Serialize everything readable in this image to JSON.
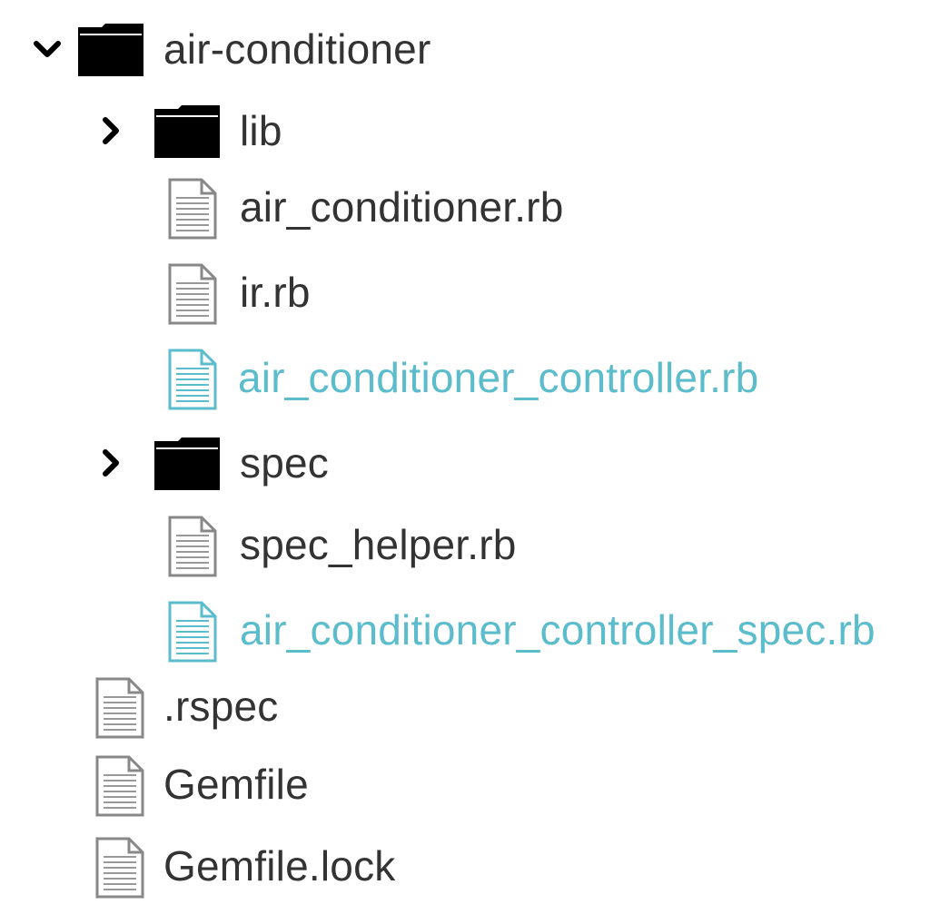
{
  "tree": {
    "root": {
      "label": "air-conditioner",
      "expanded": true
    },
    "lib": {
      "label": "lib",
      "expanded": false
    },
    "lib_files": [
      {
        "label": "air_conditioner.rb",
        "highlight": false
      },
      {
        "label": "ir.rb",
        "highlight": false
      },
      {
        "label": "air_conditioner_controller.rb",
        "highlight": true
      }
    ],
    "spec": {
      "label": "spec",
      "expanded": false
    },
    "spec_files": [
      {
        "label": "spec_helper.rb",
        "highlight": false
      },
      {
        "label": "air_conditioner_controller_spec.rb",
        "highlight": true
      }
    ],
    "root_files": [
      {
        "label": ".rspec"
      },
      {
        "label": "Gemfile"
      },
      {
        "label": "Gemfile.lock"
      }
    ]
  },
  "colors": {
    "text": "#333333",
    "highlight": "#5bbccc",
    "folder": "#000000",
    "file_icon": "#888888"
  },
  "icons": {
    "expanded": "chevron-down-icon",
    "collapsed": "chevron-right-icon",
    "folder": "folder-icon",
    "file": "file-icon"
  }
}
